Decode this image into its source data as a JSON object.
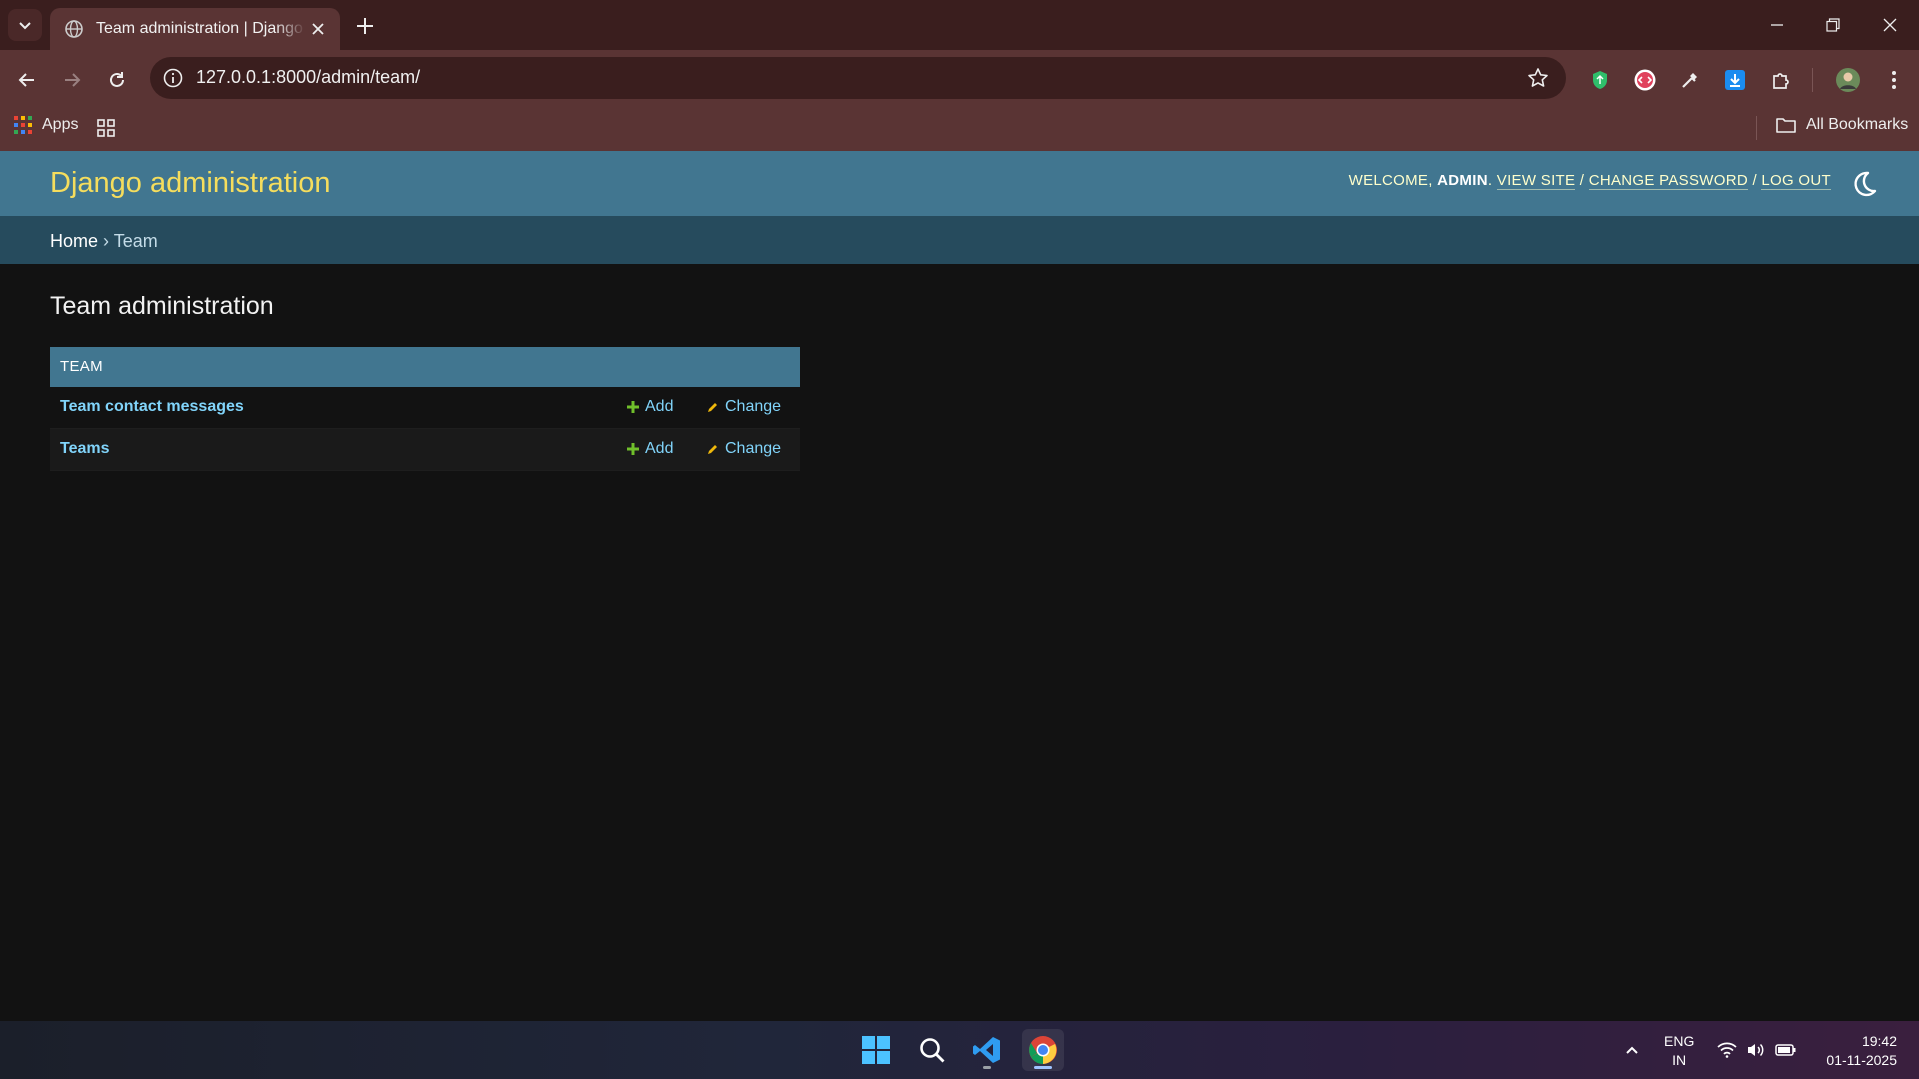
{
  "browser": {
    "tab_title": "Team administration | Django site admin",
    "url": "127.0.0.1:8000/admin/team/",
    "bookmarks": {
      "apps_label": "Apps",
      "all_bookmarks_label": "All Bookmarks"
    }
  },
  "admin": {
    "site_name": "Django administration",
    "user_tools": {
      "welcome": "WELCOME,",
      "username": "ADMIN",
      "view_site": "VIEW SITE",
      "change_password": "CHANGE PASSWORD",
      "log_out": "LOG OUT",
      "separator": "/"
    },
    "breadcrumbs": {
      "home": "Home",
      "separator": "›",
      "current": "Team"
    },
    "page_title": "Team administration",
    "module": {
      "caption": "TEAM",
      "rows": [
        {
          "name": "Team contact messages",
          "add": "Add",
          "change": "Change"
        },
        {
          "name": "Teams",
          "add": "Add",
          "change": "Change"
        }
      ]
    }
  },
  "taskbar": {
    "lang": "ENG",
    "region": "IN",
    "time": "19:42",
    "date": "01-11-2025"
  },
  "colors": {
    "header_bg": "#417690",
    "breadcrumbs_bg": "#264b5d",
    "site_name": "#f5dd5d",
    "link": "#81d4fa",
    "add_icon": "#70bf2b",
    "change_icon": "#efb80b",
    "page_bg": "#121212"
  },
  "icons": {
    "tab_search": "chevron-down-icon",
    "favicon": "globe-icon",
    "extensions": [
      "shield-icon",
      "code-icon",
      "eyedropper-icon",
      "download-icon",
      "puzzle-icon"
    ],
    "theme_toggle": "moon-icon"
  }
}
